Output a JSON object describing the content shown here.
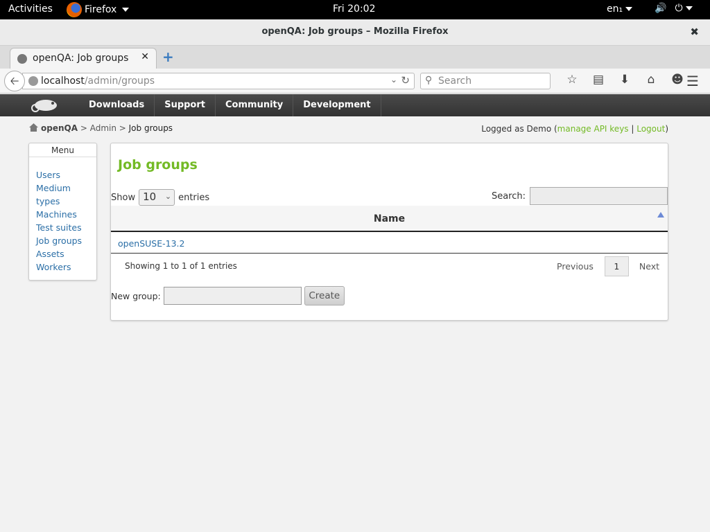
{
  "gnome": {
    "activities": "Activities",
    "app_name": "Firefox",
    "clock": "Fri 20:02",
    "lang": "en₁"
  },
  "window": {
    "title": "openQA: Job groups – Mozilla Firefox"
  },
  "tab": {
    "label": "openQA: Job groups"
  },
  "urlbar": {
    "host": "localhost",
    "path": "/admin/groups",
    "search_placeholder": "Search"
  },
  "site_nav": {
    "items": [
      "Downloads",
      "Support",
      "Community",
      "Development"
    ]
  },
  "breadcrumb": {
    "root": "openQA",
    "sep1": " > ",
    "admin": "Admin",
    "sep2": " > ",
    "current": "Job groups"
  },
  "login": {
    "prefix": "Logged as Demo (",
    "api_keys": "manage API keys",
    "sep": " | ",
    "logout": "Logout",
    "suffix": ")"
  },
  "menu": {
    "title": "Menu",
    "items": [
      "Users",
      "Medium",
      "types",
      "Machines",
      "Test suites",
      "Job groups",
      "Assets",
      "Workers"
    ]
  },
  "main": {
    "heading": "Job groups",
    "show_label": "Show",
    "entries_value": "10",
    "entries_label": "entries",
    "search_label": "Search:",
    "column_name": "Name",
    "rows": [
      "openSUSE-13.2"
    ],
    "info": "Showing 1 to 1 of 1 entries",
    "pager": {
      "previous": "Previous",
      "page": "1",
      "next": "Next"
    },
    "new_group_label": "New group:",
    "create_button": "Create"
  },
  "colors": {
    "accent_green": "#73ba25",
    "link_blue": "#2a6ea6"
  }
}
